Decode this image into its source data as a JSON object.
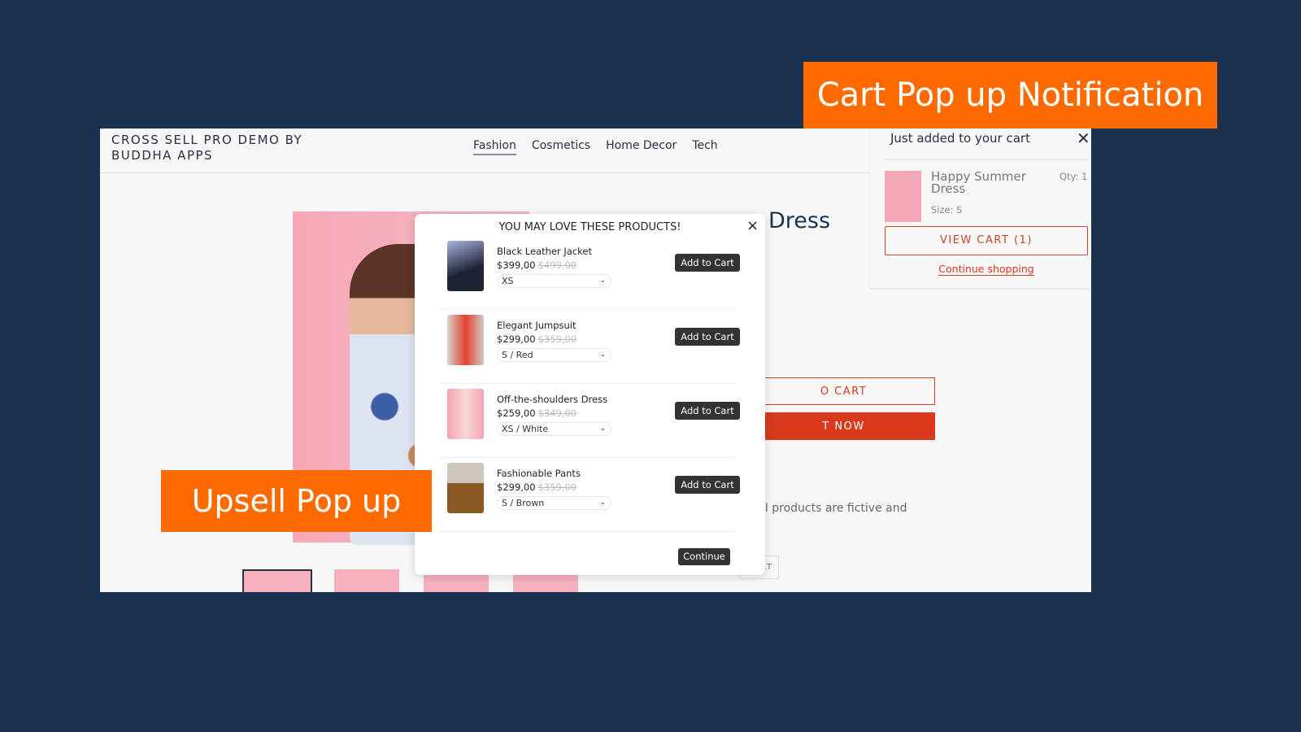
{
  "store": {
    "logo": "CROSS SELL PRO DEMO BY BUDDHA APPS",
    "nav": [
      "Fashion",
      "Cosmetics",
      "Home Decor",
      "Tech"
    ],
    "active_nav": "Fashion",
    "product_title_fragment": "Dress",
    "add_to_cart_fragment": "O CART",
    "buy_now_fragment": "T NOW",
    "description_fragment": "ll products are fictive and",
    "small_button_fragment": ".T"
  },
  "upsell": {
    "title": "YOU MAY LOVE THESE PRODUCTS!",
    "close": "×",
    "items": [
      {
        "name": "Black Leather Jacket",
        "price": "$399,00",
        "compare": "$499,00",
        "variant": "XS",
        "button": "Add to Cart"
      },
      {
        "name": "Elegant Jumpsuit",
        "price": "$299,00",
        "compare": "$359,00",
        "variant": "S / Red",
        "button": "Add to Cart"
      },
      {
        "name": "Off-the-shoulders Dress",
        "price": "$259,00",
        "compare": "$349,00",
        "variant": "XS / White",
        "button": "Add to Cart"
      },
      {
        "name": "Fashionable Pants",
        "price": "$299,00",
        "compare": "$359,00",
        "variant": "S / Brown",
        "button": "Add to Cart"
      }
    ],
    "continue": "Continue"
  },
  "cart_popup": {
    "title": "Just added to your cart",
    "close": "✕",
    "item_name": "Happy Summer Dress",
    "size": "Size: S",
    "qty": "Qty: 1",
    "view_cart": "VIEW CART (1)",
    "continue": "Continue shopping"
  },
  "labels": {
    "cart": "Cart Pop up Notification",
    "upsell": "Upsell Pop up"
  },
  "colors": {
    "background": "#1a3150",
    "accent": "#d9391d",
    "label": "#ff6a00"
  }
}
